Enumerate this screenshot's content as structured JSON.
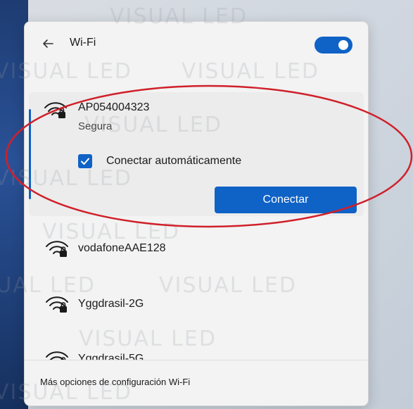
{
  "header": {
    "title": "Wi-Fi",
    "toggle_on": true
  },
  "selected_network": {
    "ssid": "AP054004323",
    "status": "Segura",
    "auto_connect_label": "Conectar automáticamente",
    "auto_connect_checked": true,
    "connect_label": "Conectar"
  },
  "networks": [
    {
      "ssid": "vodafoneAAE128"
    },
    {
      "ssid": "Yggdrasil-2G"
    },
    {
      "ssid": "Yggdrasil-5G"
    }
  ],
  "footer": {
    "link": "Más opciones de configuración Wi-Fi"
  },
  "watermark": "VISUAL LED",
  "colors": {
    "accent": "#0f62c6",
    "annotation": "#d0202a"
  },
  "icons": {
    "back": "back-arrow-icon",
    "wifi": "wifi-secured-icon",
    "check": "checkmark-icon"
  }
}
